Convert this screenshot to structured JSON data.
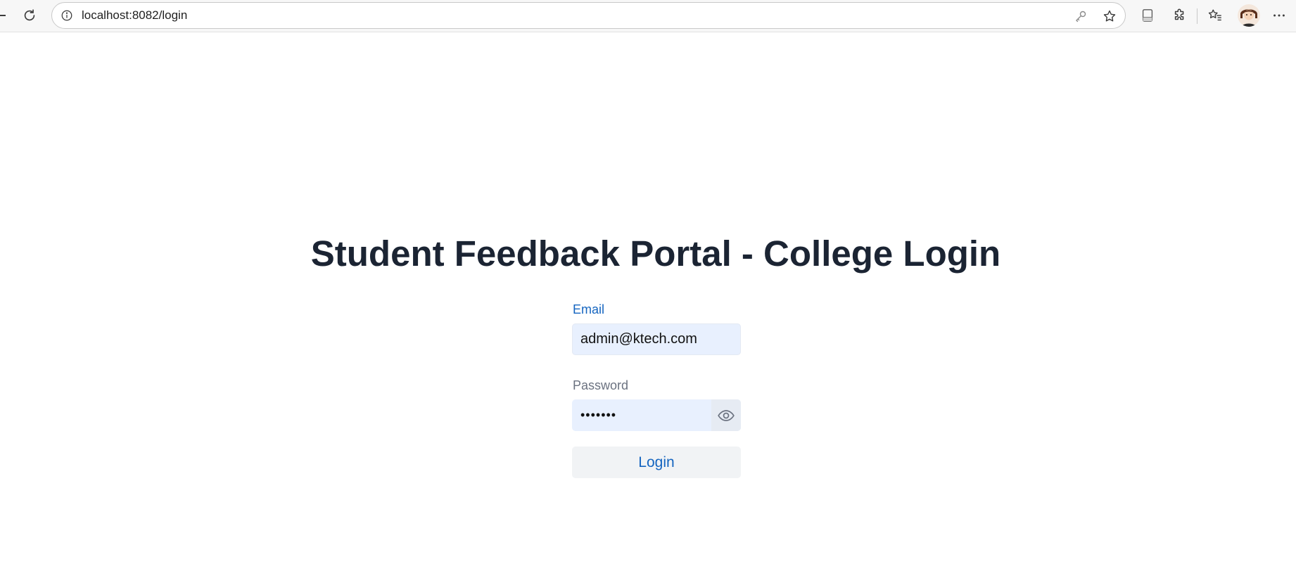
{
  "browser": {
    "url": "localhost:8082/login",
    "icons": [
      "back-icon",
      "refresh-icon",
      "site-info-icon",
      "key-icon",
      "star-icon",
      "reading-view-icon",
      "extensions-icon",
      "favorites-icon",
      "avatar",
      "more-icon"
    ]
  },
  "page": {
    "title": "Student Feedback Portal - College Login"
  },
  "form": {
    "email_label": "Email",
    "email_value": "admin@ktech.com",
    "password_label": "Password",
    "password_value": "•••••••",
    "login_label": "Login"
  },
  "colors": {
    "accent": "#1565c0",
    "title": "#1b2433",
    "input_bg": "#e8f0fe",
    "button_bg": "#f1f3f5"
  }
}
